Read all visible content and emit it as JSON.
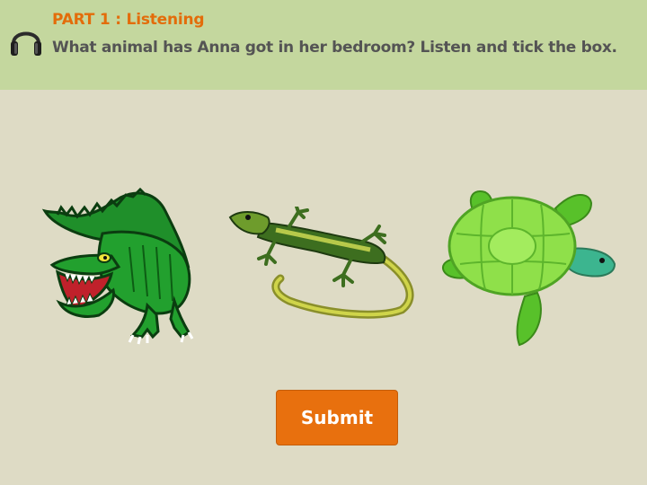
{
  "header": {
    "part_title": "PART 1 : Listening",
    "instruction": "What animal has Anna got in her bedroom? Listen and tick the box.",
    "icon": "headphones-icon"
  },
  "choices": [
    {
      "name": "crocodile",
      "icon": "crocodile-image"
    },
    {
      "name": "lizard",
      "icon": "lizard-image"
    },
    {
      "name": "turtle",
      "icon": "turtle-image"
    }
  ],
  "submit": {
    "label": "Submit"
  },
  "colors": {
    "background": "#dedbc5",
    "header_background": "#c4d79e",
    "title": "#e36c0a",
    "instruction": "#545454",
    "submit_button": "#e8700e"
  }
}
